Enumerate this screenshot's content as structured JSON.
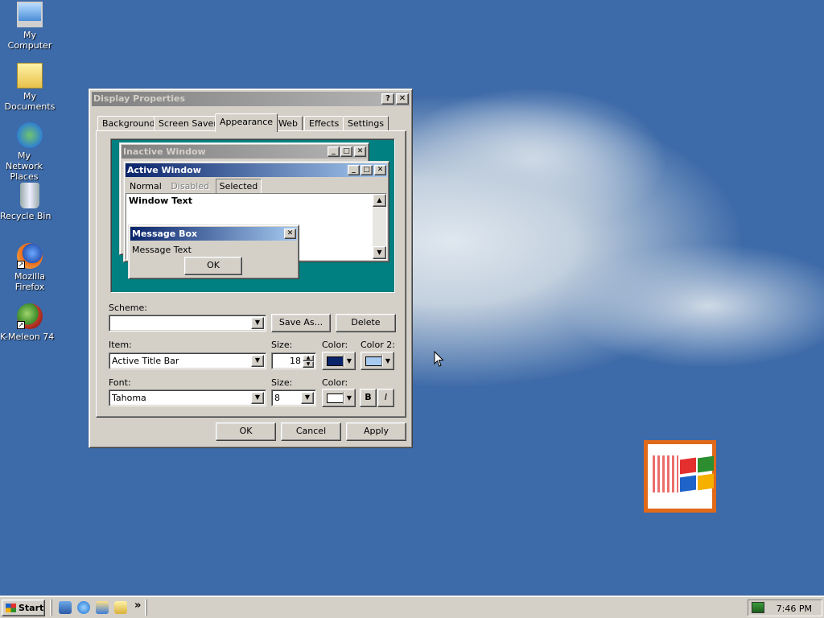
{
  "desktop": {
    "icons": [
      {
        "label": "My Computer",
        "icon": "computer-icon"
      },
      {
        "label": "My Documents",
        "icon": "folder-documents-icon"
      },
      {
        "label": "My Network Places",
        "icon": "network-places-icon"
      },
      {
        "label": "Recycle Bin",
        "icon": "recycle-bin-icon"
      },
      {
        "label": "Mozilla Firefox",
        "icon": "firefox-icon"
      },
      {
        "label": "K-Meleon 74",
        "icon": "k-meleon-icon"
      }
    ]
  },
  "dialog": {
    "title": "Display Properties",
    "help_glyph": "?",
    "close_glyph": "✕",
    "tabs": [
      "Background",
      "Screen Saver",
      "Appearance",
      "Web",
      "Effects",
      "Settings"
    ],
    "active_tab": "Appearance",
    "preview": {
      "inactive_title": "Inactive Window",
      "active_title": "Active Window",
      "menu_normal": "Normal",
      "menu_disabled": "Disabled",
      "menu_selected": "Selected",
      "window_text": "Window Text",
      "msgbox_title": "Message Box",
      "msgbox_text": "Message Text",
      "msgbox_ok": "OK"
    },
    "scheme_label": "Scheme:",
    "scheme_value": "",
    "save_as_label": "Save As...",
    "delete_label": "Delete",
    "item_label": "Item:",
    "item_value": "Active Title Bar",
    "item_size_label": "Size:",
    "item_size_value": "18",
    "item_color_label": "Color:",
    "item_color2_label": "Color 2:",
    "font_label": "Font:",
    "font_value": "Tahoma",
    "font_size_label": "Size:",
    "font_size_value": "8",
    "font_color_label": "Color:",
    "bold_label": "B",
    "italic_label": "I",
    "ok_label": "OK",
    "cancel_label": "Cancel",
    "apply_label": "Apply",
    "colors": {
      "item_color": "#0a246a",
      "item_color2": "#a6caf0",
      "font_color": "#ffffff"
    }
  },
  "taskbar": {
    "start_label": "Start",
    "quicklaunch": [
      "show-desktop-icon",
      "internet-explorer-icon",
      "outlook-express-icon",
      "search-icon"
    ],
    "chevron": "»",
    "clock": "7:46 PM"
  }
}
